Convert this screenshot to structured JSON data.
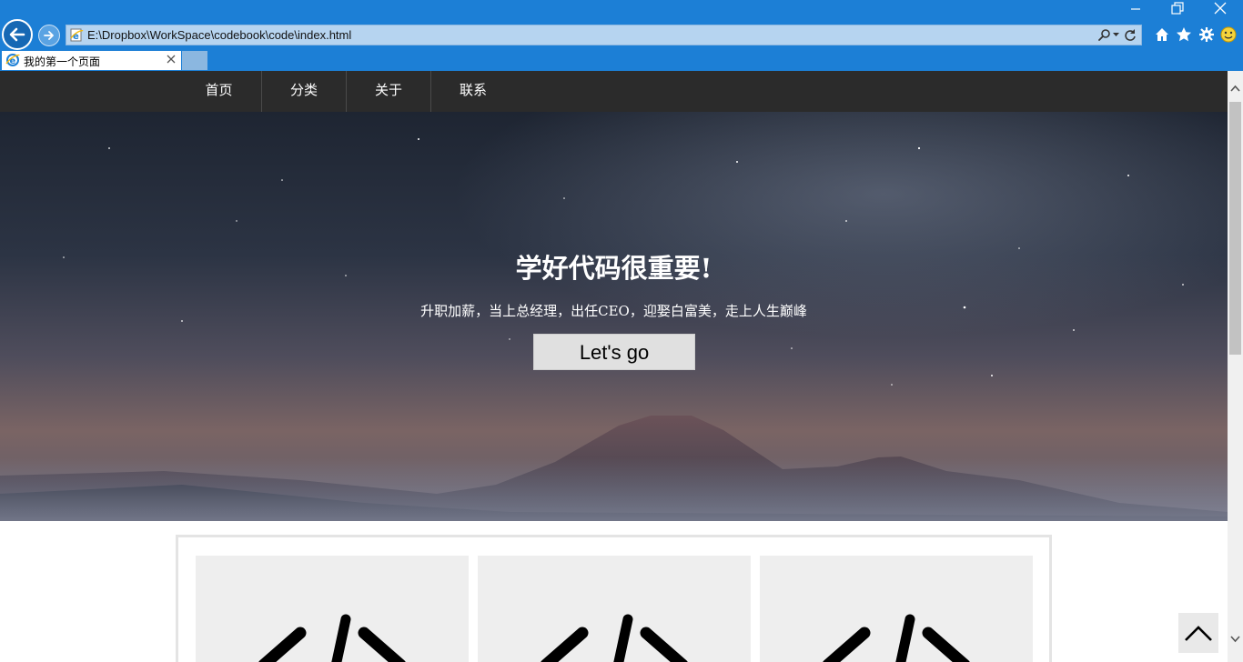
{
  "browser": {
    "address": "E:\\Dropbox\\WorkSpace\\codebook\\code\\index.html",
    "tab_title": "我的第一个页面",
    "accent_color": "#1c7fd6",
    "icons": [
      "back-arrow-icon",
      "forward-arrow-icon",
      "ie-favicon-icon",
      "search-icon",
      "dropdown-icon",
      "refresh-icon",
      "minimize-icon",
      "restore-icon",
      "close-icon",
      "home-icon",
      "star-icon",
      "gear-icon",
      "smiley-icon"
    ]
  },
  "nav": {
    "items": [
      {
        "label": "首页"
      },
      {
        "label": "分类"
      },
      {
        "label": "关于"
      },
      {
        "label": "联系"
      }
    ],
    "background": "#2b2b2b"
  },
  "hero": {
    "title": "学好代码很重要!",
    "subtitle": "升职加薪，当上总经理，出任CEO，迎娶白富美，走上人生巅峰",
    "button_label": "Let's go"
  },
  "cards": [
    {
      "icon": "code-icon"
    },
    {
      "icon": "code-icon"
    },
    {
      "icon": "code-icon"
    }
  ],
  "back_to_top": {
    "icon": "chevron-up-icon"
  }
}
